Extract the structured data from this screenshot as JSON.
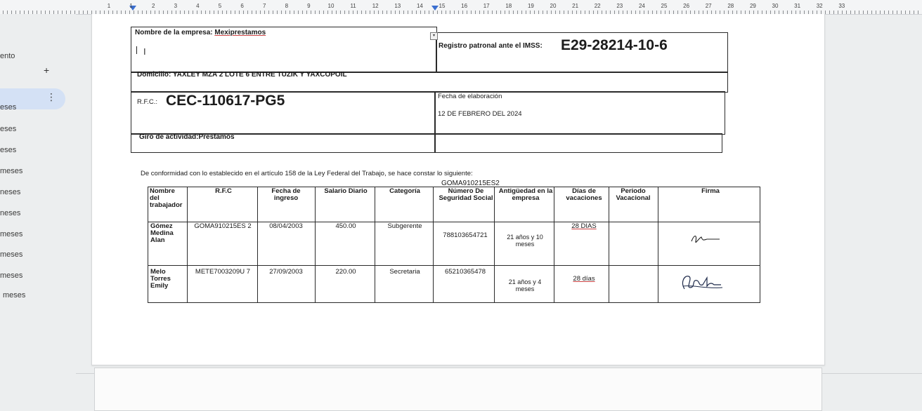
{
  "ruler": {
    "numbers": [
      "1",
      "1",
      "2",
      "3",
      "4",
      "5",
      "6",
      "7",
      "8",
      "9",
      "10",
      "11",
      "12",
      "13",
      "14",
      "15",
      "16",
      "17",
      "18",
      "19",
      "20",
      "21",
      "22",
      "23",
      "24",
      "25",
      "26",
      "27",
      "28",
      "29",
      "30",
      "31",
      "32",
      "33"
    ]
  },
  "sidebar": {
    "items": [
      "ento",
      "",
      "eses",
      "eses",
      "eses",
      "meses",
      "neses",
      "neses",
      "meses",
      "meses",
      "meses",
      "meses"
    ],
    "add_icon": "plus-icon",
    "more_icon": "vertical-dots-icon"
  },
  "header_block": {
    "empresa_label": "Nombre de la empresa: ",
    "empresa_value": "Mexiprestamos",
    "registro_label": "Registro patronal ante el IMSS:",
    "registro_value": "E29-28214-10-6",
    "domicilio": "Domicilio: YAXLEY MZA 2 LOTE 6 ENTRE TUZIK Y YAXCOPOIL",
    "rfc_label": "R.F.C.:",
    "rfc_value": "CEC-110617-PG5",
    "fecha_label": "Fecha de elaboración",
    "fecha_value": "12 DE FEBRERO DEL 2024",
    "giro": "Giro de actividad:Prestamos"
  },
  "statement": "De conformidad con lo establecido en el artículo 158 de la Ley Federal del Trabajo, se hace constar lo siguiente:",
  "above_table_text": "GOMA910215ES2",
  "table": {
    "headers": [
      "Nombre del trabajador",
      "R.F.C",
      "Fecha de ingreso",
      "Salario Diario",
      "Categoría",
      "Número De Seguridad Social",
      "Antigüedad en la empresa",
      "Días de vacaciones",
      "Periodo Vacacional",
      "Firma"
    ],
    "rows": [
      {
        "nombre": "Gómez Medina Alan",
        "rfc": "GOMA910215ES 2",
        "fecha": "08/04/2003",
        "salario": "450.00",
        "categoria": "Subgerente",
        "nss": "788103654721",
        "antiguedad": "21 años y 10 meses",
        "dias": "28 DIAS",
        "periodo": "",
        "firma": "signature"
      },
      {
        "nombre": "Melo Torres Emily",
        "rfc": "METE7003209U 7",
        "fecha": "27/09/2003",
        "salario": "220.00",
        "categoria": "Secretaria",
        "nss": "65210365478",
        "antiguedad": "21 años y 4 meses",
        "dias": "28 días",
        "periodo": "",
        "firma": "signature"
      }
    ]
  },
  "colors": {
    "accent": "#3b6fd0",
    "sidebar_active": "#d4e1f5",
    "page": "#ffffff",
    "background": "#eceeef"
  }
}
